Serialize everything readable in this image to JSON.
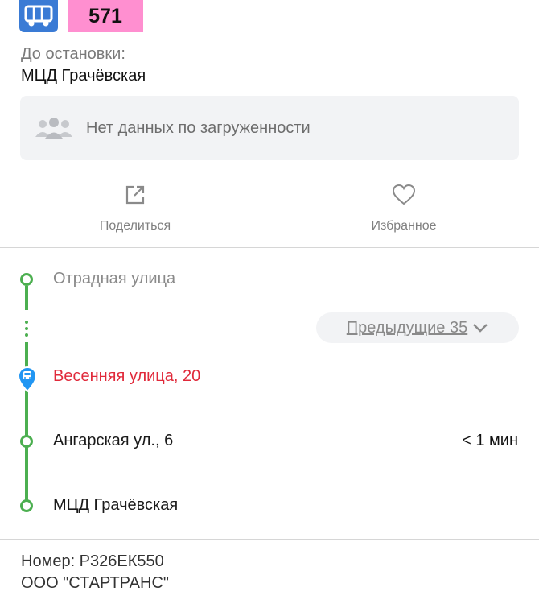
{
  "route": {
    "number": "571",
    "badge_color": "#ff8fd0",
    "icon": "bus-icon",
    "icon_bg": "#3a7bd5"
  },
  "destination": {
    "label": "До остановки:",
    "value": "МЦД Грачёвская"
  },
  "load": {
    "icon": "people-icon",
    "text": "Нет данных по загруженности"
  },
  "actions": {
    "share": {
      "icon": "share-icon",
      "label": "Поделиться"
    },
    "favorite": {
      "icon": "heart-icon",
      "label": "Избранное"
    }
  },
  "stops": {
    "first": {
      "name": "Отрадная улица"
    },
    "previous_toggle": {
      "label": "Предыдущие 35",
      "icon": "chevron-down-icon"
    },
    "current": {
      "name": "Весенняя улица, 20",
      "icon": "bus-pin-icon"
    },
    "next": {
      "name": "Ангарская ул., 6",
      "eta": "< 1 мин"
    },
    "last": {
      "name": "МЦД Грачёвская"
    }
  },
  "colors": {
    "route_line": "#4caf50",
    "current_stop": "#e0293a",
    "pin": "#2196f3"
  },
  "vehicle": {
    "plate": "Номер: Р326ЕК550",
    "operator": "ООО \"СТАРТРАНС\""
  }
}
